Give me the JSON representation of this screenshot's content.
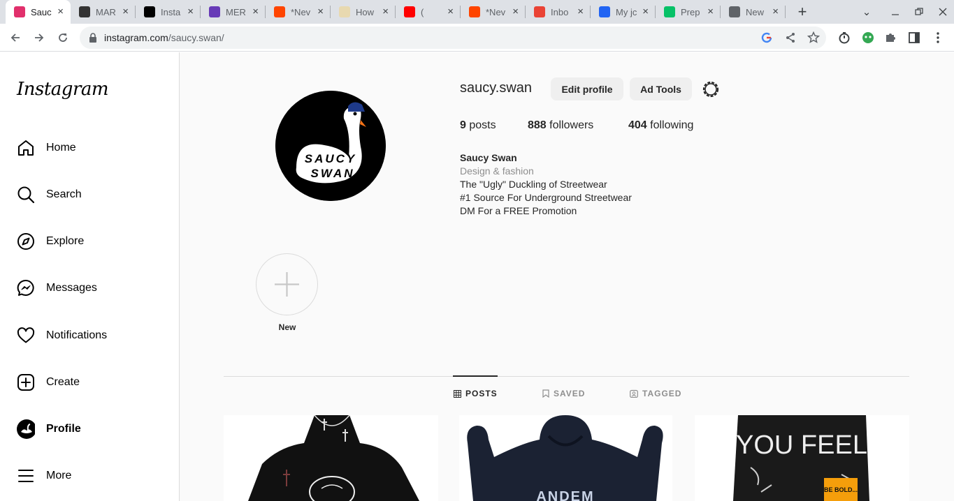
{
  "browser": {
    "tabs": [
      {
        "title": "Sauc",
        "favicon": "instagram-icon",
        "color": "#e1306c",
        "active": true
      },
      {
        "title": "MAR",
        "favicon": "hand-logo-icon",
        "color": "#333333",
        "active": false
      },
      {
        "title": "Insta",
        "favicon": "v-logo-icon",
        "color": "#000000",
        "active": false
      },
      {
        "title": "MER",
        "favicon": "forms-icon",
        "color": "#673ab7",
        "active": false
      },
      {
        "title": "*Nev",
        "favicon": "reddit-icon",
        "color": "#ff4500",
        "active": false
      },
      {
        "title": "How",
        "favicon": "hands-icon",
        "color": "#e8d9b0",
        "active": false
      },
      {
        "title": "(",
        "favicon": "youtube-icon",
        "color": "#ff0000",
        "active": false
      },
      {
        "title": "*Nev",
        "favicon": "reddit-icon",
        "color": "#ff4500",
        "active": false
      },
      {
        "title": "Inbo",
        "favicon": "gmail-icon",
        "color": "#ea4335",
        "active": false
      },
      {
        "title": "My jc",
        "favicon": "indeed-icon",
        "color": "#2164f3",
        "active": false
      },
      {
        "title": "Prep",
        "favicon": "uber-eats-icon",
        "color": "#06c167",
        "active": false
      },
      {
        "title": "New",
        "favicon": "chrome-icon",
        "color": "#5f6368",
        "active": false
      }
    ],
    "url_domain": "instagram.com",
    "url_path": "/saucy.swan/"
  },
  "sidebar": {
    "logo": "Instagram",
    "items": [
      {
        "label": "Home",
        "icon": "home-icon"
      },
      {
        "label": "Search",
        "icon": "search-icon"
      },
      {
        "label": "Explore",
        "icon": "compass-icon"
      },
      {
        "label": "Messages",
        "icon": "messenger-icon"
      },
      {
        "label": "Notifications",
        "icon": "heart-icon"
      },
      {
        "label": "Create",
        "icon": "plus-square-icon"
      },
      {
        "label": "Profile",
        "icon": "avatar-icon"
      },
      {
        "label": "More",
        "icon": "menu-icon"
      }
    ]
  },
  "profile": {
    "username": "saucy.swan",
    "edit_button": "Edit profile",
    "ad_tools_button": "Ad Tools",
    "posts_count": "9",
    "posts_label": "posts",
    "followers_count": "888",
    "followers_label": "followers",
    "following_count": "404",
    "following_label": "following",
    "full_name": "Saucy Swan",
    "category": "Design & fashion",
    "bio_lines": [
      "The \"Ugly\" Duckling of Streetwear",
      "#1 Source For Underground Streetwear",
      "DM For a FREE Promotion"
    ],
    "avatar_text_1": "SAUCY",
    "avatar_text_2": "SWAN",
    "highlight_new_label": "New",
    "tabs": [
      "POSTS",
      "SAVED",
      "TAGGED"
    ],
    "post_2_text": "ANDEM",
    "post_3_text": "YOU FEEL",
    "post_3_badge": "BE BOLD..."
  }
}
